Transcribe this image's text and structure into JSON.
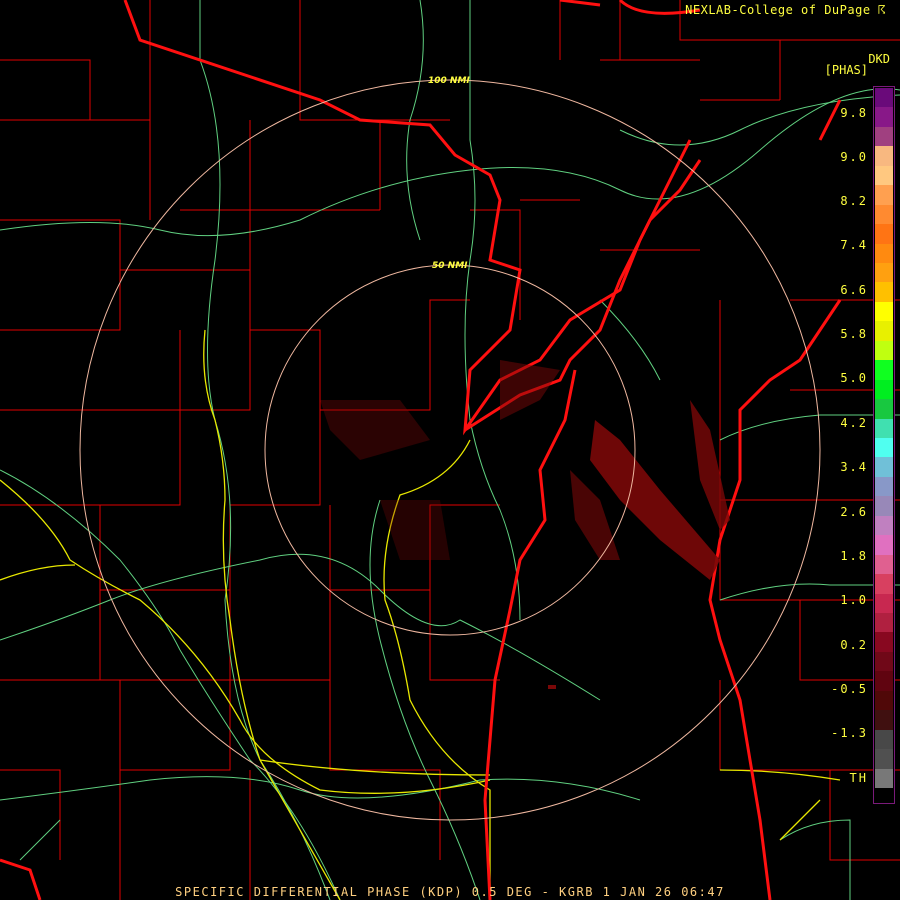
{
  "header": {
    "credit": "NEXLAB-College of DuPage ☈",
    "product": "DKD",
    "units": "[PHAS]"
  },
  "range_rings": [
    {
      "label": "50 NMI"
    },
    {
      "label": "100 NMI"
    }
  ],
  "colorbar": {
    "ticks": [
      "9.8",
      "9.0",
      "8.2",
      "7.4",
      "6.6",
      "5.8",
      "5.0",
      "4.2",
      "3.4",
      "2.6",
      "1.8",
      "1.0",
      "0.2",
      "-0.5",
      "-1.3",
      "TH"
    ],
    "colors": [
      "#6a0a7a",
      "#881888",
      "#a04080",
      "#f8b880",
      "#ffc880",
      "#ffa050",
      "#ff8a30",
      "#ff7414",
      "#ff8a10",
      "#ffa010",
      "#ffc000",
      "#ffff00",
      "#e8f000",
      "#c0ff10",
      "#10ff20",
      "#00ee20",
      "#18c840",
      "#40e0b0",
      "#50fff0",
      "#70c0d8",
      "#8898c8",
      "#9888b8",
      "#c080c0",
      "#e070c0",
      "#e06090",
      "#d84060",
      "#c82850",
      "#b02040",
      "#880820",
      "#700818",
      "#600410",
      "#500808",
      "#401010",
      "#484848",
      "#505050",
      "#787878"
    ]
  },
  "footer": {
    "caption": "SPECIFIC DIFFERENTIAL PHASE (KDP) 0.5 DEG - KGRB 1 JAN 26 06:47"
  }
}
